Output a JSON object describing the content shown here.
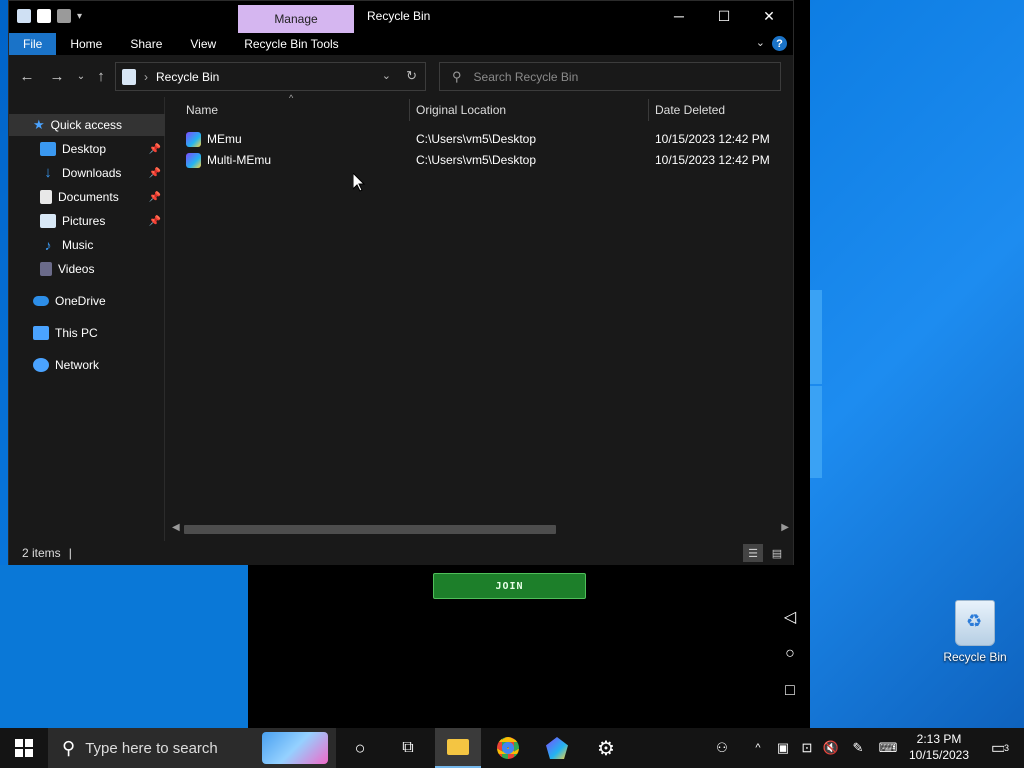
{
  "window": {
    "title": "Recycle Bin",
    "manage_tab": "Manage",
    "controls": {
      "minimize": "─",
      "maximize": "☐",
      "close": "✕"
    }
  },
  "ribbon": {
    "tabs": [
      "File",
      "Home",
      "Share",
      "View",
      "Recycle Bin Tools"
    ],
    "help": "?"
  },
  "address": {
    "location": "Recycle Bin",
    "search_placeholder": "Search Recycle Bin"
  },
  "nav_pane": {
    "quick_access": "Quick access",
    "items": [
      {
        "label": "Desktop",
        "icon": "desktop-icon",
        "pinned": true
      },
      {
        "label": "Downloads",
        "icon": "downloads-icon",
        "pinned": true
      },
      {
        "label": "Documents",
        "icon": "documents-icon",
        "pinned": true
      },
      {
        "label": "Pictures",
        "icon": "pictures-icon",
        "pinned": true
      },
      {
        "label": "Music",
        "icon": "music-icon",
        "pinned": false
      },
      {
        "label": "Videos",
        "icon": "videos-icon",
        "pinned": false
      }
    ],
    "onedrive": "OneDrive",
    "this_pc": "This PC",
    "network": "Network"
  },
  "columns": {
    "name": "Name",
    "original_location": "Original Location",
    "date_deleted": "Date Deleted"
  },
  "files": [
    {
      "name": "MEmu",
      "original_location": "C:\\Users\\vm5\\Desktop",
      "date_deleted": "10/15/2023 12:42 PM"
    },
    {
      "name": "Multi-MEmu",
      "original_location": "C:\\Users\\vm5\\Desktop",
      "date_deleted": "10/15/2023 12:42 PM"
    }
  ],
  "status": {
    "item_count": "2 items"
  },
  "background_app": {
    "join_button": "JOIN"
  },
  "desktop": {
    "recycle_bin_label": "Recycle Bin"
  },
  "taskbar": {
    "search_placeholder": "Type here to search",
    "time": "2:13 PM",
    "date": "10/15/2023",
    "notification_count": "3"
  },
  "colors": {
    "accent": "#1a73c8",
    "manage_tab": "#d5b6f0",
    "join_green": "#1d7f2a"
  }
}
